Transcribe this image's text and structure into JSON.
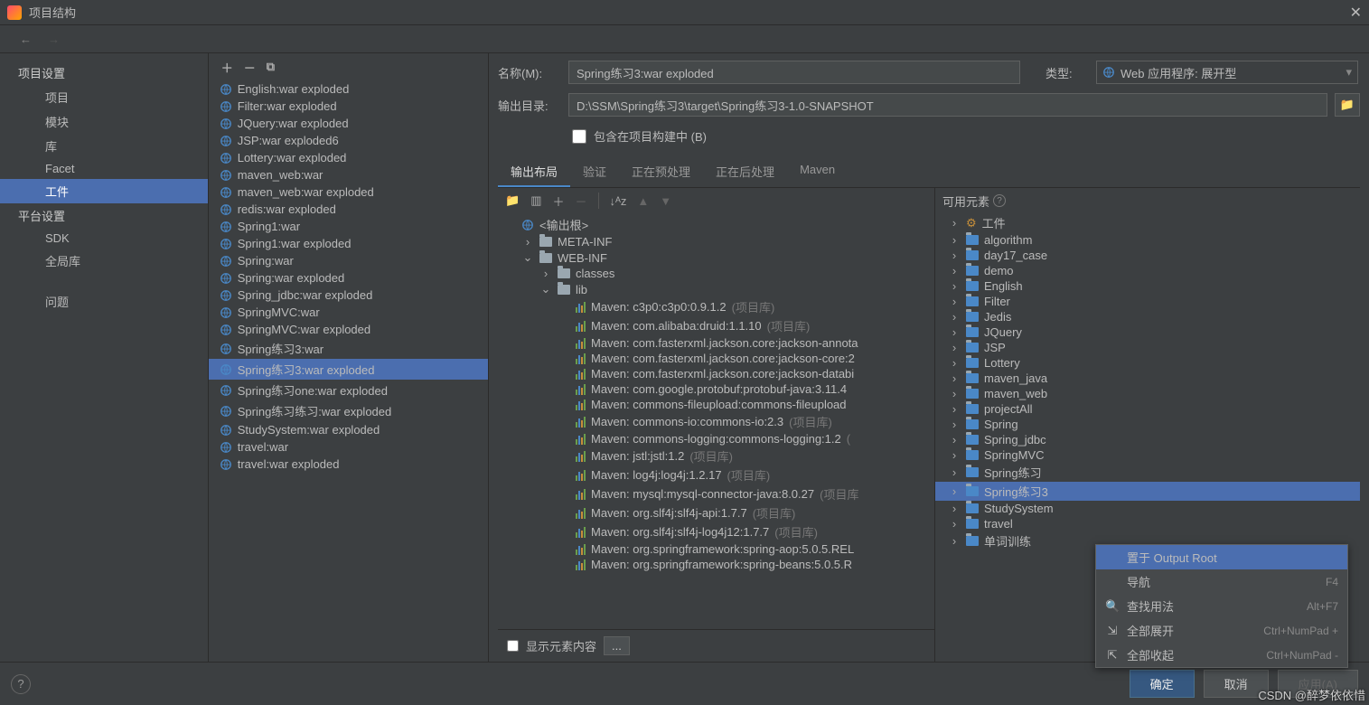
{
  "window": {
    "title": "项目结构"
  },
  "sidebar": {
    "section1": "项目设置",
    "items1": [
      "项目",
      "模块",
      "库",
      "Facet",
      "工件"
    ],
    "section2": "平台设置",
    "items2": [
      "SDK",
      "全局库"
    ],
    "problems": "问题"
  },
  "artifacts": [
    "English:war exploded",
    "Filter:war exploded",
    "JQuery:war exploded",
    "JSP:war exploded6",
    "Lottery:war exploded",
    "maven_web:war",
    "maven_web:war exploded",
    "redis:war exploded",
    "Spring1:war",
    "Spring1:war exploded",
    "Spring:war",
    "Spring:war exploded",
    "Spring_jdbc:war exploded",
    "SpringMVC:war",
    "SpringMVC:war exploded",
    "Spring练习3:war",
    "Spring练习3:war exploded",
    "Spring练习one:war exploded",
    "Spring练习练习:war exploded",
    "StudySystem:war exploded",
    "travel:war",
    "travel:war exploded"
  ],
  "artifact_selected": "Spring练习3:war exploded",
  "form": {
    "name_label": "名称(M):",
    "name_value": "Spring练习3:war exploded",
    "type_label": "类型:",
    "type_value": "Web 应用程序: 展开型",
    "out_label": "输出目录:",
    "out_value": "D:\\SSM\\Spring练习3\\target\\Spring练习3-1.0-SNAPSHOT",
    "include_label": "包含在项目构建中 (B)"
  },
  "tabs": [
    "输出布局",
    "验证",
    "正在预处理",
    "正在后处理",
    "Maven"
  ],
  "output_tree": {
    "root": "<输出根>",
    "meta": "META-INF",
    "web": "WEB-INF",
    "classes": "classes",
    "lib": "lib",
    "libs": [
      {
        "t": "Maven: c3p0:c3p0:0.9.1.2",
        "m": "(项目库)"
      },
      {
        "t": "Maven: com.alibaba:druid:1.1.10",
        "m": "(项目库)"
      },
      {
        "t": "Maven: com.fasterxml.jackson.core:jackson-annota",
        "m": ""
      },
      {
        "t": "Maven: com.fasterxml.jackson.core:jackson-core:2",
        "m": ""
      },
      {
        "t": "Maven: com.fasterxml.jackson.core:jackson-databi",
        "m": ""
      },
      {
        "t": "Maven: com.google.protobuf:protobuf-java:3.11.4",
        "m": ""
      },
      {
        "t": "Maven: commons-fileupload:commons-fileupload",
        "m": ""
      },
      {
        "t": "Maven: commons-io:commons-io:2.3",
        "m": "(项目库)"
      },
      {
        "t": "Maven: commons-logging:commons-logging:1.2",
        "m": "("
      },
      {
        "t": "Maven: jstl:jstl:1.2",
        "m": "(项目库)"
      },
      {
        "t": "Maven: log4j:log4j:1.2.17",
        "m": "(项目库)"
      },
      {
        "t": "Maven: mysql:mysql-connector-java:8.0.27",
        "m": "(项目库"
      },
      {
        "t": "Maven: org.slf4j:slf4j-api:1.7.7",
        "m": "(项目库)"
      },
      {
        "t": "Maven: org.slf4j:slf4j-log4j12:1.7.7",
        "m": "(项目库)"
      },
      {
        "t": "Maven: org.springframework:spring-aop:5.0.5.REL",
        "m": ""
      },
      {
        "t": "Maven: org.springframework:spring-beans:5.0.5.R",
        "m": ""
      }
    ]
  },
  "show_elements": "显示元素内容",
  "available": {
    "header": "可用元素",
    "truncated_top": "工件",
    "items": [
      "algorithm",
      "day17_case",
      "demo",
      "English",
      "Filter",
      "Jedis",
      "JQuery",
      "JSP",
      "Lottery",
      "maven_java",
      "maven_web",
      "projectAll",
      "Spring",
      "Spring_jdbc",
      "SpringMVC",
      "Spring练习",
      "Spring练习3",
      "StudySystem",
      "travel",
      "单词训练"
    ],
    "selected": "Spring练习3"
  },
  "context_menu": [
    {
      "label": "置于 Output Root",
      "shortcut": ""
    },
    {
      "label": "导航",
      "shortcut": "F4"
    },
    {
      "label": "查找用法",
      "shortcut": "Alt+F7"
    },
    {
      "label": "全部展开",
      "shortcut": "Ctrl+NumPad +"
    },
    {
      "label": "全部收起",
      "shortcut": "Ctrl+NumPad -"
    }
  ],
  "footer": {
    "ok": "确定",
    "cancel": "取消",
    "apply": "应用(A)"
  },
  "watermark": "CSDN @醉梦依依惜"
}
